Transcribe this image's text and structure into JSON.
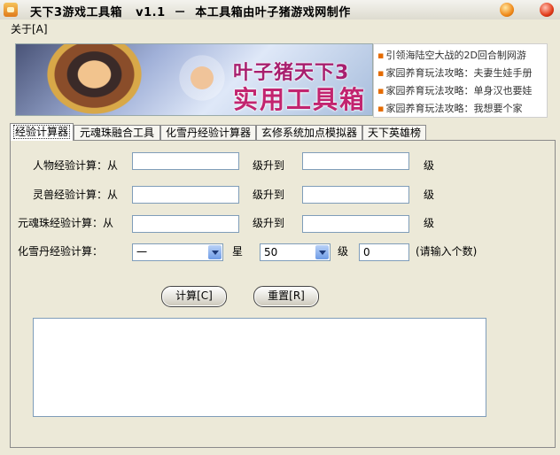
{
  "window": {
    "title": "天下3游戏工具箱   v1.1  －  本工具箱由叶子猪游戏网制作",
    "minimize_icon": "minimize-icon",
    "close_icon": "close-icon"
  },
  "menu": {
    "about": "关于[A]"
  },
  "banner": {
    "line1": "叶子猪天下3",
    "line2": "实用工具箱"
  },
  "links": [
    "引领海陆空大战的2D回合制网游",
    "家园养育玩法攻略：夫妻生娃手册",
    "家园养育玩法攻略：单身汉也要娃",
    "家园养育玩法攻略：我想要个家"
  ],
  "tabs": [
    "经验计算器",
    "元魂珠融合工具",
    "化雪丹经验计算器",
    "玄修系统加点模拟器",
    "天下英雄榜"
  ],
  "form": {
    "rows": [
      {
        "label": "人物经验计算：从",
        "mid": "级升到",
        "end": "级"
      },
      {
        "label": "灵兽经验计算：从",
        "mid": "级升到",
        "end": "级"
      },
      {
        "label": "元魂珠经验计算：从",
        "mid": "级升到",
        "end": "级"
      }
    ],
    "xuedan": {
      "label": "化雪丹经验计算：",
      "star_value": "一",
      "star_label": "星",
      "level_value": "50",
      "level_label": "级",
      "count_value": "0",
      "hint": "(请输入个数)"
    }
  },
  "buttons": {
    "calc": "计算[C]",
    "reset": "重置[R]"
  }
}
